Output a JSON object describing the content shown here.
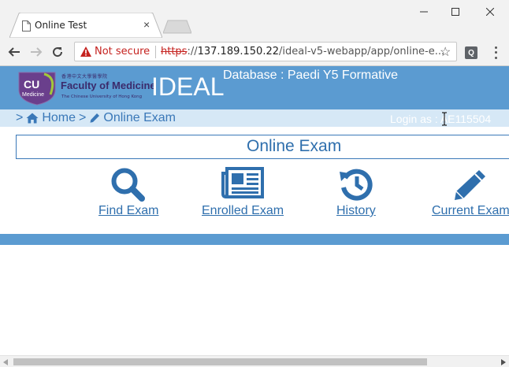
{
  "browser": {
    "tab_title": "Online Test",
    "tab_close": "×",
    "security_text": "Not secure",
    "url_scheme": "https",
    "url_sep": "://",
    "url_host": "137.189.150.22",
    "url_path": "/ideal-v5-webapp/app/online-e...",
    "star": "☆",
    "extension_label": "Q"
  },
  "header": {
    "logo_cu": "CU",
    "logo_medicine": "Medicine",
    "logo_chinese": "香港中文大學醫學院",
    "logo_faculty": "Faculty of Medicine",
    "logo_english": "The Chinese University of Hong Kong",
    "app_name": "IDEAL",
    "database_label": "Database : Paedi Y5 Formative"
  },
  "breadcrumb": {
    "prefix": ">",
    "home": "Home",
    "separator": ">",
    "current": "Online Exam"
  },
  "user": {
    "login_text": "Login as : AE115504"
  },
  "main": {
    "title": "Online Exam",
    "actions": [
      {
        "label": "Find Exam",
        "icon": "search-icon"
      },
      {
        "label": "Enrolled Exam",
        "icon": "newspaper-icon"
      },
      {
        "label": "History",
        "icon": "history-icon"
      },
      {
        "label": "Current Exam",
        "icon": "pencil-icon"
      }
    ]
  },
  "colors": {
    "header_blue": "#5b9bd1",
    "link_blue": "#2f6fad",
    "breadcrumb_bg": "#d6e8f6",
    "insecure_red": "#c5221f"
  }
}
